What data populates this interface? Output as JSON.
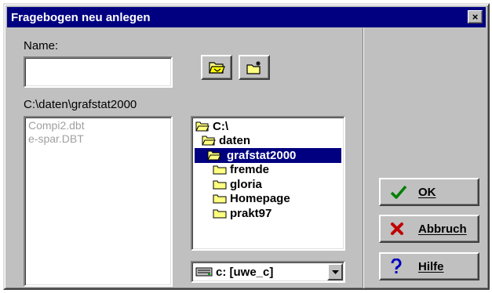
{
  "window": {
    "title": "Fragebogen neu anlegen",
    "close_label": "×"
  },
  "name_field": {
    "label": "Name:",
    "value": ""
  },
  "current_path": "C:\\daten\\grafstat2000",
  "files": [
    "Compi2.dbt",
    "e-spar.DBT"
  ],
  "directories": [
    {
      "name": "C:\\",
      "indent": 0,
      "open": true,
      "selected": false
    },
    {
      "name": "daten",
      "indent": 1,
      "open": true,
      "selected": false
    },
    {
      "name": "grafstat2000",
      "indent": 2,
      "open": true,
      "selected": true
    },
    {
      "name": "fremde",
      "indent": 3,
      "open": false,
      "selected": false
    },
    {
      "name": "gloria",
      "indent": 3,
      "open": false,
      "selected": false
    },
    {
      "name": "Homepage",
      "indent": 3,
      "open": false,
      "selected": false
    },
    {
      "name": "prakt97",
      "indent": 3,
      "open": false,
      "selected": false
    }
  ],
  "drive": {
    "selected": "c: [uwe_c]"
  },
  "buttons": {
    "ok": "OK",
    "cancel": "Abbruch",
    "help": "Hilfe"
  },
  "colors": {
    "selection": "#000080",
    "folder": "#ffff80",
    "ok_check": "#008000",
    "cancel_x": "#c00000",
    "help_q": "#0000c0"
  },
  "icons": {
    "open_folder_button": "open-folder-icon",
    "new_folder_button": "new-folder-icon"
  }
}
